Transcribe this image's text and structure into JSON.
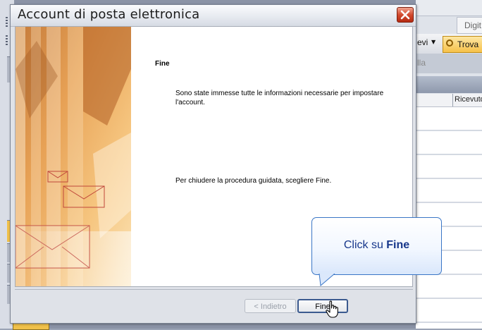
{
  "dialog": {
    "title": "Account di posta elettronica",
    "heading": "Fine",
    "paragraph1": "Sono state immesse tutte le informazioni necessarie per impostare l'account.",
    "paragraph2": "Per chiudere la procedura guidata, scegliere Fine.",
    "buttons": {
      "back": "< Indietro",
      "finish": "Fine"
    }
  },
  "callout": {
    "prefix": "Click su ",
    "emphasis": "Fine"
  },
  "background_app": {
    "search_field": "Digit",
    "toolbar_button_fragment": "evi",
    "find_button": "Trova",
    "filter_fragment": "lla",
    "column_header": "Ricevuto"
  },
  "colors": {
    "callout_border": "#3a76c6",
    "callout_text": "#17378a",
    "close_button": "#d24a2e",
    "find_button": "#f6c14a"
  }
}
